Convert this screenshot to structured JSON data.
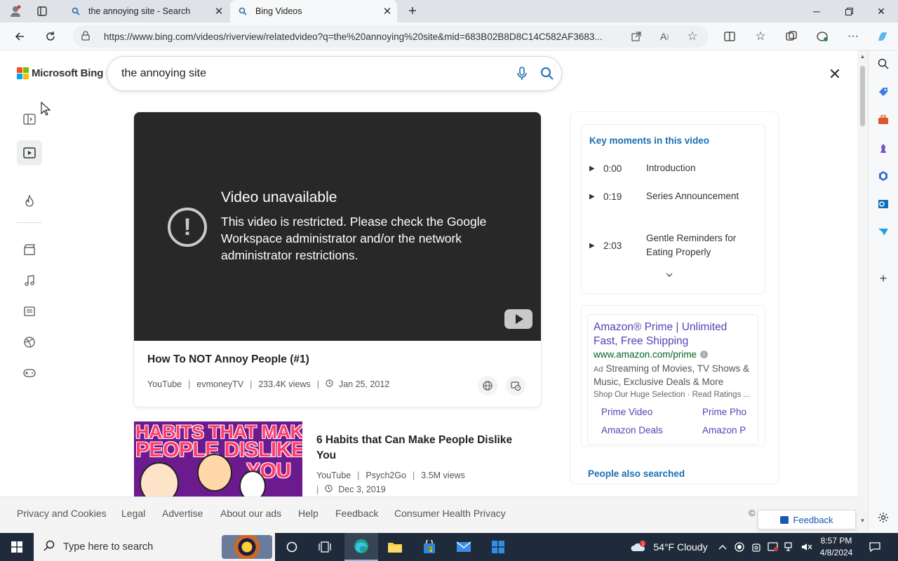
{
  "browser": {
    "tabs": [
      {
        "title": "the annoying site - Search",
        "active": false
      },
      {
        "title": "Bing Videos",
        "active": true
      }
    ],
    "new_tab_label": "+",
    "url": "https://www.bing.com/videos/riverview/relatedvideo?q=the%20annoying%20site&mid=683B02B8D8C14C582AF3683..."
  },
  "bing": {
    "logo_text": "Microsoft Bing",
    "search_value": "the annoying site"
  },
  "video": {
    "error_title": "Video unavailable",
    "error_message": "This video is restricted. Please check the Google Workspace administrator and/or the network administrator restrictions.",
    "title": "How To NOT Annoy People (#1)",
    "source": "YouTube",
    "channel": "evmoneyTV",
    "views": "233.4K views",
    "date": "Jan 25, 2012"
  },
  "result2": {
    "thumb_line1": "HABITS THAT MAKE",
    "thumb_line2": "PEOPLE DISLIKE",
    "thumb_line3": "YOU",
    "title": "6 Habits that Can Make People Dislike You",
    "source": "YouTube",
    "channel": "Psych2Go",
    "views": "3.5M views",
    "date": "Dec 3, 2019"
  },
  "key_moments": {
    "title": "Key moments in this video",
    "items": [
      {
        "time": "0:00",
        "label": "Introduction"
      },
      {
        "time": "0:19",
        "label": "Series Announcement"
      },
      {
        "time": "2:03",
        "label": "Gentle Reminders for Eating Properly"
      }
    ]
  },
  "ad": {
    "title": "Amazon® Prime | Unlimited Fast, Free Shipping",
    "url": "www.amazon.com/prime",
    "tag": "Ad",
    "description": "Streaming of Movies, TV Shows & Music, Exclusive Deals & More",
    "sub": "Shop Our Huge Selection · Read Ratings ...",
    "links": [
      "Prime Video",
      "Prime Pho",
      "Amazon Deals",
      "Amazon P"
    ]
  },
  "people_also_searched": "People also searched",
  "footer": {
    "links": [
      "Privacy and Cookies",
      "Legal",
      "Advertise",
      "About our ads",
      "Help",
      "Feedback",
      "Consumer Health Privacy"
    ],
    "copyright": "©",
    "feedback_button": "Feedback"
  },
  "taskbar": {
    "search_placeholder": "Type here to search",
    "weather": "54°F  Cloudy",
    "time": "8:57 PM",
    "date": "4/8/2024"
  },
  "colors": {
    "accent_blue": "#1a6fb5",
    "ad_link": "#5a3fb5",
    "ad_url": "#006621",
    "player_bg": "#282828"
  }
}
